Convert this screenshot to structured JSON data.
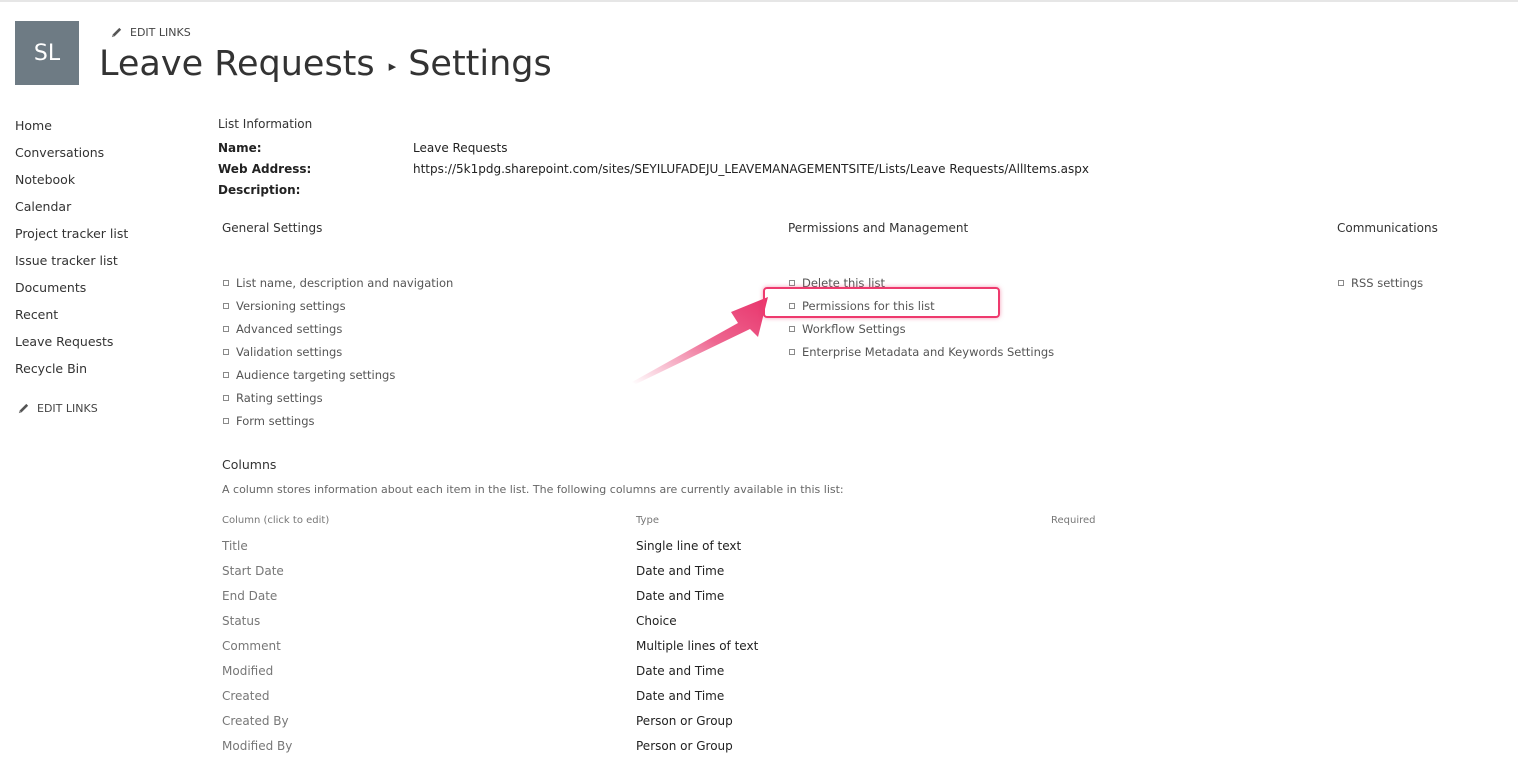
{
  "header": {
    "logo_initials": "SL",
    "edit_links": "EDIT LINKS",
    "title_list": "Leave Requests",
    "title_separator": "▸",
    "title_page": "Settings"
  },
  "leftnav": {
    "items": [
      "Home",
      "Conversations",
      "Notebook",
      "Calendar",
      "Project tracker list",
      "Issue tracker list",
      "Documents",
      "Recent",
      "Leave Requests",
      "Recycle Bin"
    ],
    "edit_links": "EDIT LINKS"
  },
  "list_info": {
    "heading": "List Information",
    "name_label": "Name:",
    "name_value": "Leave Requests",
    "web_address_label": "Web Address:",
    "web_address_value": "https://5k1pdg.sharepoint.com/sites/SEYILUFADEJU_LEAVEMANAGEMENTSITE/Lists/Leave Requests/AllItems.aspx",
    "description_label": "Description:"
  },
  "general_settings": {
    "heading": "General Settings",
    "links": [
      "List name, description and navigation",
      "Versioning settings",
      "Advanced settings",
      "Validation settings",
      "Audience targeting settings",
      "Rating settings",
      "Form settings"
    ]
  },
  "permissions_management": {
    "heading": "Permissions and Management",
    "links": [
      "Delete this list",
      "Permissions for this list",
      "Workflow Settings",
      "Enterprise Metadata and Keywords Settings"
    ],
    "highlighted_index": 1
  },
  "communications": {
    "heading": "Communications",
    "links": [
      "RSS settings"
    ]
  },
  "columns": {
    "heading": "Columns",
    "description": "A column stores information about each item in the list. The following columns are currently available in this list:",
    "headers": [
      "Column (click to edit)",
      "Type",
      "Required"
    ],
    "rows": [
      {
        "name": "Title",
        "type": "Single line of text"
      },
      {
        "name": "Start Date",
        "type": "Date and Time"
      },
      {
        "name": "End Date",
        "type": "Date and Time"
      },
      {
        "name": "Status",
        "type": "Choice"
      },
      {
        "name": "Comment",
        "type": "Multiple lines of text"
      },
      {
        "name": "Modified",
        "type": "Date and Time"
      },
      {
        "name": "Created",
        "type": "Date and Time"
      },
      {
        "name": "Created By",
        "type": "Person or Group"
      },
      {
        "name": "Modified By",
        "type": "Person or Group"
      }
    ]
  },
  "colors": {
    "logo_bg": "#6e7b84",
    "highlight": "#ee3a6e",
    "arrow": "#e8336b"
  },
  "icons": {
    "edit": "pencil-icon",
    "bullet": "square-bullet-icon",
    "annotation": "arrow-annotation"
  }
}
